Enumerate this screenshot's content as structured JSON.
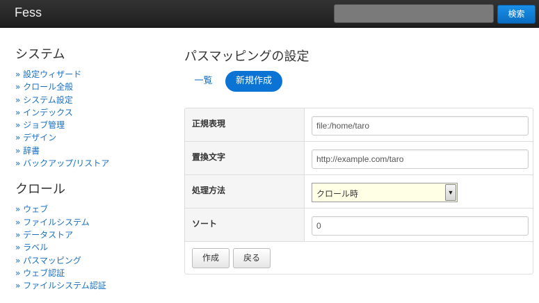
{
  "navbar": {
    "brand": "Fess",
    "search_placeholder": "",
    "search_button": "検索"
  },
  "sidebar": {
    "sections": [
      {
        "heading": "システム",
        "items": [
          "設定ウィザード",
          "クロール全般",
          "システム設定",
          "インデックス",
          "ジョブ管理",
          "デザイン",
          "辞書",
          "バックアップ/リストア"
        ]
      },
      {
        "heading": "クロール",
        "items": [
          "ウェブ",
          "ファイルシステム",
          "データストア",
          "ラベル",
          "パスマッピング",
          "ウェブ認証",
          "ファイルシステム認証"
        ]
      }
    ]
  },
  "main": {
    "title": "パスマッピングの設定",
    "tabs": {
      "list": "一覧",
      "create": "新規作成"
    },
    "form": {
      "regex_label": "正規表現",
      "regex_value": "file:/home/taro",
      "replacement_label": "置換文字",
      "replacement_value": "http://example.com/taro",
      "process_label": "処理方法",
      "process_value": "クロール時",
      "sort_label": "ソート",
      "sort_value": "0"
    },
    "buttons": {
      "create": "作成",
      "back": "戻る"
    }
  }
}
